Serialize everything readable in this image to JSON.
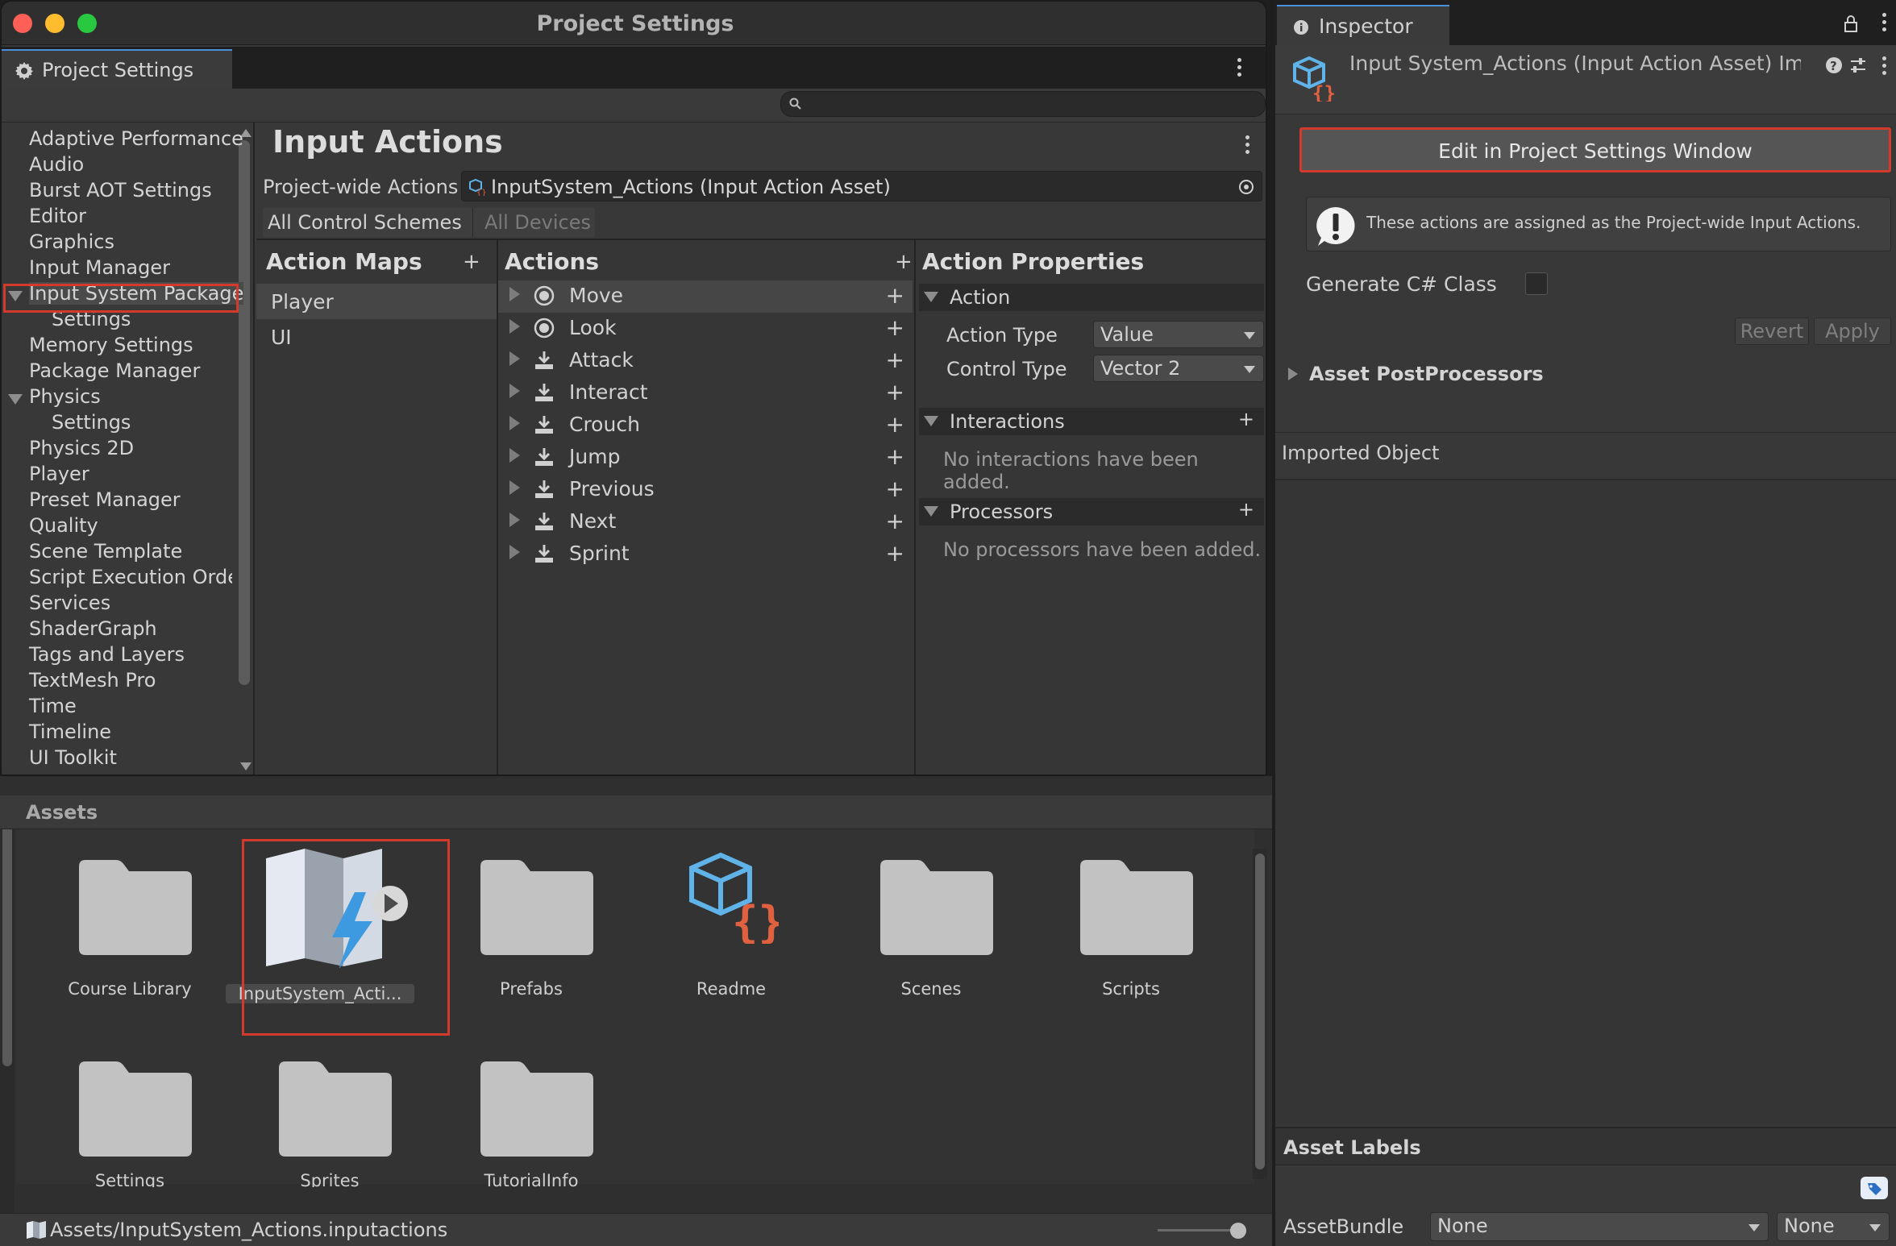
{
  "window": {
    "title": "Project Settings",
    "tab_label": "Project Settings",
    "search_placeholder": ""
  },
  "settings_nav": {
    "items": [
      {
        "label": "Adaptive Performance",
        "indent": 0
      },
      {
        "label": "Audio",
        "indent": 0
      },
      {
        "label": "Burst AOT Settings",
        "indent": 0
      },
      {
        "label": "Editor",
        "indent": 0
      },
      {
        "label": "Graphics",
        "indent": 0
      },
      {
        "label": "Input Manager",
        "indent": 0
      },
      {
        "label": "Input System Package",
        "indent": 0,
        "expanded": true,
        "selected": true
      },
      {
        "label": "Settings",
        "indent": 1
      },
      {
        "label": "Memory Settings",
        "indent": 0
      },
      {
        "label": "Package Manager",
        "indent": 0
      },
      {
        "label": "Physics",
        "indent": 0,
        "expanded": true
      },
      {
        "label": "Settings",
        "indent": 1
      },
      {
        "label": "Physics 2D",
        "indent": 0
      },
      {
        "label": "Player",
        "indent": 0
      },
      {
        "label": "Preset Manager",
        "indent": 0
      },
      {
        "label": "Quality",
        "indent": 0
      },
      {
        "label": "Scene Template",
        "indent": 0
      },
      {
        "label": "Script Execution Order",
        "indent": 0
      },
      {
        "label": "Services",
        "indent": 0
      },
      {
        "label": "ShaderGraph",
        "indent": 0
      },
      {
        "label": "Tags and Layers",
        "indent": 0
      },
      {
        "label": "TextMesh Pro",
        "indent": 0
      },
      {
        "label": "Time",
        "indent": 0
      },
      {
        "label": "Timeline",
        "indent": 0
      },
      {
        "label": "UI Toolkit",
        "indent": 0
      }
    ]
  },
  "input_actions": {
    "title": "Input Actions",
    "project_wide_label": "Project-wide Actions",
    "project_wide_value": "InputSystem_Actions (Input Action Asset)",
    "control_schemes": "All Control Schemes",
    "devices": "All Devices",
    "maps_header": "Action Maps",
    "actions_header": "Actions",
    "props_header": "Action Properties",
    "maps": [
      {
        "label": "Player",
        "selected": true
      },
      {
        "label": "UI",
        "selected": false
      }
    ],
    "actions": [
      {
        "label": "Move",
        "icon": "target-icon",
        "selected": true
      },
      {
        "label": "Look",
        "icon": "target-icon"
      },
      {
        "label": "Attack",
        "icon": "press-icon"
      },
      {
        "label": "Interact",
        "icon": "press-icon"
      },
      {
        "label": "Crouch",
        "icon": "press-icon"
      },
      {
        "label": "Jump",
        "icon": "press-icon"
      },
      {
        "label": "Previous",
        "icon": "press-icon"
      },
      {
        "label": "Next",
        "icon": "press-icon"
      },
      {
        "label": "Sprint",
        "icon": "press-icon"
      }
    ],
    "props": {
      "action_section": "Action",
      "action_type_label": "Action Type",
      "action_type_value": "Value",
      "control_type_label": "Control Type",
      "control_type_value": "Vector 2",
      "interactions_section": "Interactions",
      "interactions_empty": "No interactions have been added.",
      "processors_section": "Processors",
      "processors_empty": "No processors have been added."
    }
  },
  "project": {
    "header": "Assets",
    "assets": [
      {
        "name": "Course Library",
        "type": "folder"
      },
      {
        "name": "InputSystem_Acti...",
        "type": "input-actions",
        "selected": true
      },
      {
        "name": "Prefabs",
        "type": "folder"
      },
      {
        "name": "Readme",
        "type": "script-asset"
      },
      {
        "name": "Scenes",
        "type": "folder"
      },
      {
        "name": "Scripts",
        "type": "folder"
      },
      {
        "name": "Settings",
        "type": "folder"
      },
      {
        "name": "Sprites",
        "type": "folder"
      },
      {
        "name": "TutorialInfo",
        "type": "folder"
      }
    ],
    "path": "Assets/InputSystem_Actions.inputactions"
  },
  "inspector": {
    "tab_label": "Inspector",
    "title": "Input System_Actions (Input Action Asset) Imp",
    "edit_button": "Edit in Project Settings Window",
    "info_text": "These actions are assigned as the Project-wide Input Actions.",
    "generate_label": "Generate C# Class",
    "revert": "Revert",
    "apply": "Apply",
    "postprocessors": "Asset PostProcessors",
    "imported_object": "Imported Object",
    "asset_labels": "Asset Labels",
    "assetbundle_label": "AssetBundle",
    "assetbundle_value": "None",
    "assetbundle_variant": "None"
  },
  "colors": {
    "highlight_red": "#d23a2c",
    "accent_blue": "#4a90d9",
    "panel_bg": "#383838",
    "selected_row": "#464646"
  }
}
